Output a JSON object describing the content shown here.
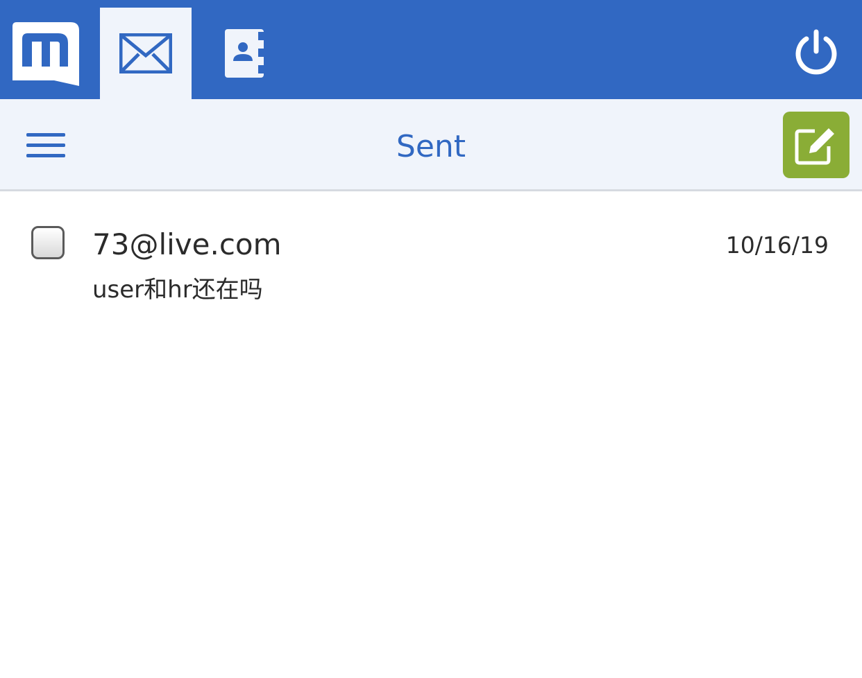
{
  "app": {
    "logo_icon": "mail-logo-m",
    "brand_color": "#3168c2",
    "compose_color": "#8aad36"
  },
  "tabs": [
    {
      "icon": "envelope-icon",
      "selected": true
    },
    {
      "icon": "contacts-book-icon",
      "selected": false
    }
  ],
  "header": {
    "menu_icon": "hamburger-icon",
    "folder_title": "Sent",
    "compose_icon": "compose-icon",
    "power_icon": "power-icon"
  },
  "messages": [
    {
      "sender": "73@live.com",
      "date": "10/16/19",
      "subject": "user和hr还在吗",
      "checked": false
    }
  ]
}
